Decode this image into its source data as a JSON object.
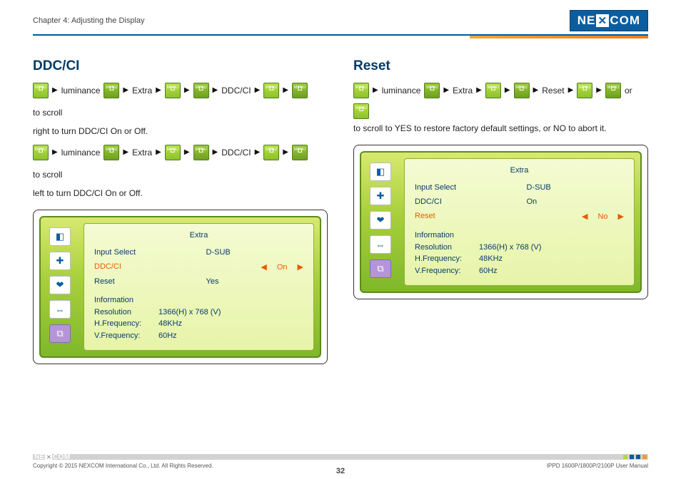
{
  "header": {
    "chapter": "Chapter 4: Adjusting the Display",
    "brand_left": "NE",
    "brand_right": "COM"
  },
  "left": {
    "title": "DDC/CI",
    "seq1": {
      "a": "luminance",
      "b": "Extra",
      "c": "DDC/CI",
      "tail": "to scroll"
    },
    "desc1": "right to turn DDC/CI On or Off.",
    "seq2": {
      "a": "luminance",
      "b": "Extra",
      "c": "DDC/CI",
      "tail": "to scroll"
    },
    "desc2": "left to turn DDC/CI On or Off.",
    "panel": {
      "title": "Extra",
      "input_label": "Input Select",
      "input_val": "D-SUB",
      "hl_label": "DDC/CI",
      "hl_val": "On",
      "reset_label": "Reset",
      "reset_val": "Yes",
      "info_title": "Information",
      "res_k": "Resolution",
      "res_v": "1366(H)  x  768 (V)",
      "hf_k": "H.Frequency:",
      "hf_v": "48KHz",
      "vf_k": "V.Frequency:",
      "vf_v": "60Hz"
    }
  },
  "right": {
    "title": "Reset",
    "seq": {
      "a": "luminance",
      "b": "Extra",
      "c": "Reset",
      "tail": "or"
    },
    "desc": "to scroll to YES to restore factory default settings, or NO to abort it.",
    "panel": {
      "title": "Extra",
      "input_label": "Input Select",
      "input_val": "D-SUB",
      "ddc_label": "DDC/CI",
      "ddc_val": "On",
      "hl_label": "Reset",
      "hl_val": "No",
      "info_title": "Information",
      "res_k": "Resolution",
      "res_v": "1366(H)  x  768 (V)",
      "hf_k": "H.Frequency:",
      "hf_v": "48KHz",
      "vf_k": "V.Frequency:",
      "vf_v": "60Hz"
    }
  },
  "footer": {
    "copyright": "Copyright © 2015 NEXCOM International Co., Ltd. All Rights Reserved.",
    "page_num": "32",
    "doc": "IPPD 1600P/1800P/2100P User Manual"
  },
  "btn_label": "MENU"
}
